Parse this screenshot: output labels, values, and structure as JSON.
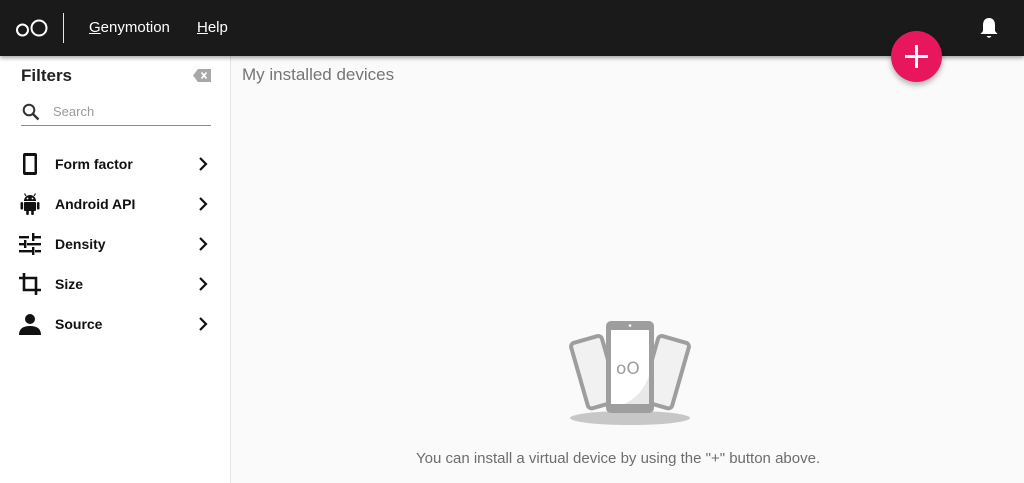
{
  "app": {
    "logo_text": "oO"
  },
  "topbar": {
    "menu": [
      {
        "label": "Genymotion",
        "mnemonic": "G",
        "rest": "enymotion"
      },
      {
        "label": "Help",
        "mnemonic": "H",
        "rest": "elp"
      }
    ],
    "notification_icon": "bell-icon"
  },
  "fab": {
    "label": "+",
    "icon": "plus-icon",
    "color": "#e8175d"
  },
  "sidebar": {
    "title": "Filters",
    "clear_icon": "backspace-icon",
    "search": {
      "placeholder": "Search",
      "value": ""
    },
    "filters": [
      {
        "label": "Form factor",
        "icon": "phone-icon"
      },
      {
        "label": "Android API",
        "icon": "android-icon"
      },
      {
        "label": "Density",
        "icon": "sliders-icon"
      },
      {
        "label": "Size",
        "icon": "crop-icon"
      },
      {
        "label": "Source",
        "icon": "person-icon"
      }
    ]
  },
  "main": {
    "title": "My installed devices",
    "empty_message": "You can install a virtual device by using the \"+\" button above.",
    "illustration_text": "oO"
  },
  "colors": {
    "topbar": "#1a1a1a",
    "accent": "#e8175d",
    "background": "#fafafa"
  }
}
